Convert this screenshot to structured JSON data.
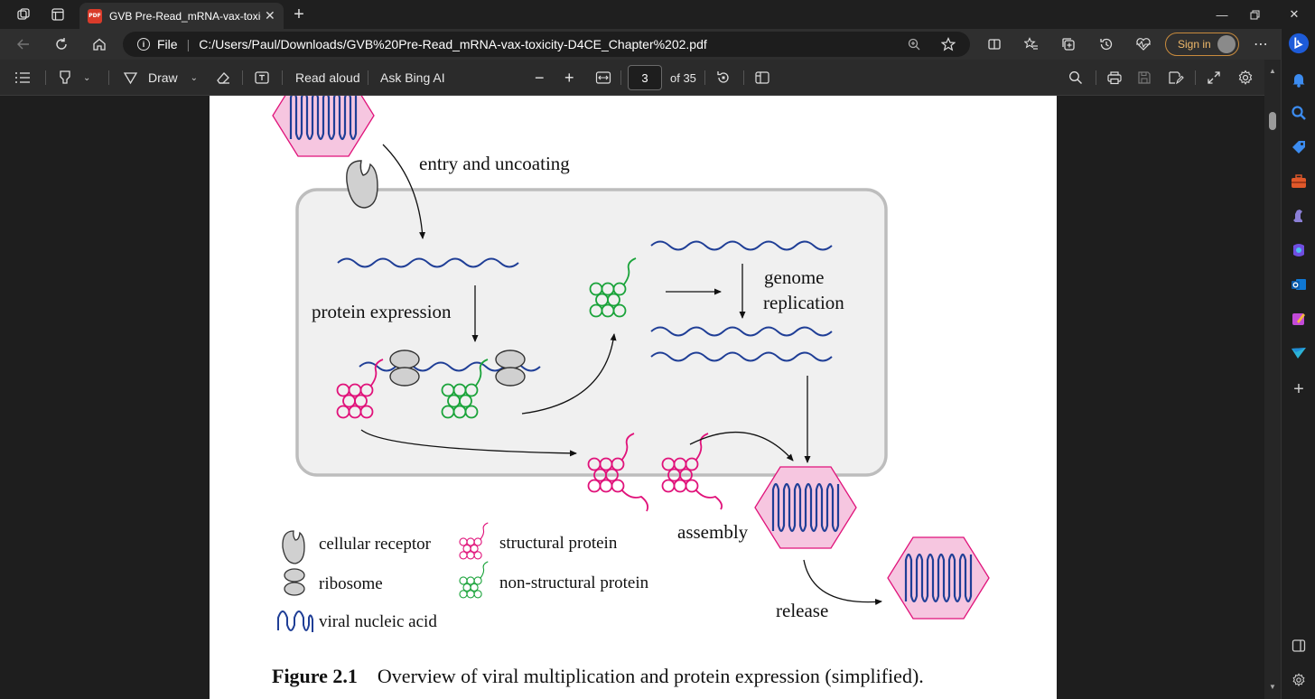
{
  "browser": {
    "tab_title": "GVB Pre-Read_mRNA-vax-toxicity",
    "tab_badge": "PDF",
    "address_scheme": "File",
    "address_url": "C:/Users/Paul/Downloads/GVB%20Pre-Read_mRNA-vax-toxicity-D4CE_Chapter%202.pdf",
    "signin_label": "Sign in"
  },
  "pdf_toolbar": {
    "draw_label": "Draw",
    "read_aloud_label": "Read aloud",
    "ask_bing_label": "Ask Bing AI",
    "page_number": "3",
    "page_total": "of 35"
  },
  "figure": {
    "labels": {
      "entry": "entry and uncoating",
      "protein_expression": "protein expression",
      "genome": "genome",
      "replication": "replication",
      "assembly": "assembly",
      "release": "release"
    },
    "legend": {
      "cellular_receptor": "cellular receptor",
      "ribosome": "ribosome",
      "viral_nucleic_acid": "viral nucleic acid",
      "structural_protein": "structural protein",
      "non_structural_protein": "non-structural protein"
    },
    "caption_number": "Figure 2.1",
    "caption_text": "Overview of viral multiplication and protein expression (simplified).",
    "colors": {
      "nucleic_acid": "#1f3e96",
      "structural_protein": "#e0127a",
      "non_structural_protein": "#1aa33a",
      "virion_fill": "#f6c6e0",
      "cell_fill": "#f0f0f0"
    }
  },
  "icons": {
    "titlebar": [
      "workspaces-icon",
      "tab-actions-icon"
    ],
    "nav": [
      "back-icon",
      "refresh-icon",
      "home-icon"
    ],
    "sidebar": [
      "bing-icon",
      "bell-icon",
      "search-icon",
      "tag-icon",
      "briefcase-icon",
      "chess-icon",
      "copilot-icon",
      "outlook-icon",
      "designer-icon",
      "send-icon",
      "add-icon"
    ]
  }
}
